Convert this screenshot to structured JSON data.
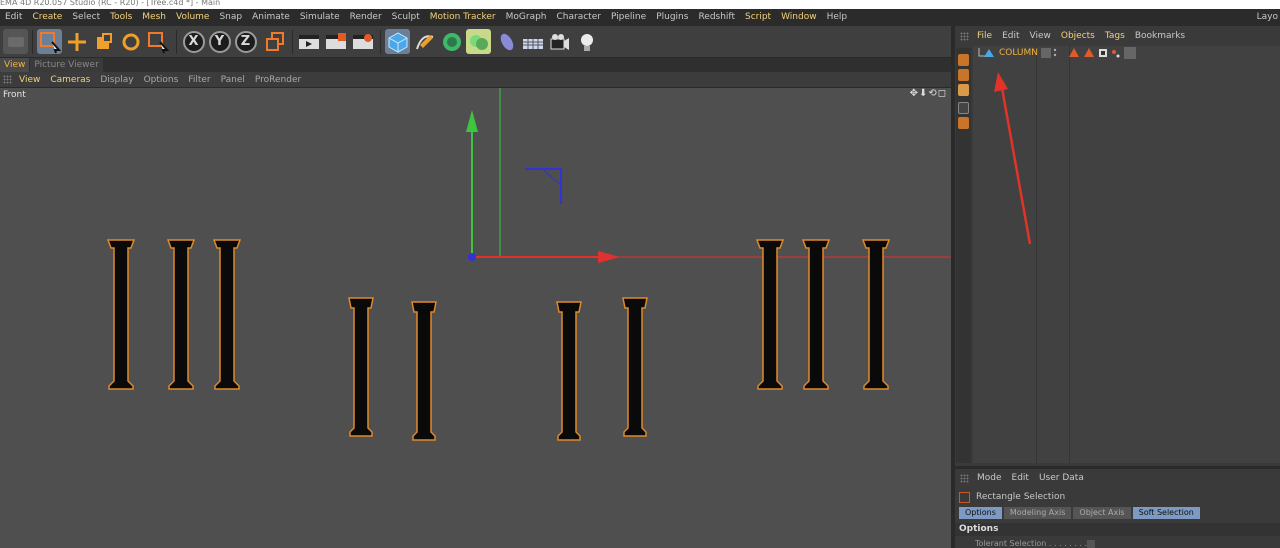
{
  "window": {
    "title": "EMA 4D R20.057 Studio (RC - R20) - [Tree.c4d *] - Main"
  },
  "menubar": {
    "items": [
      {
        "label": "Edit",
        "hl": false
      },
      {
        "label": "Create",
        "hl": true
      },
      {
        "label": "Select",
        "hl": false
      },
      {
        "label": "Tools",
        "hl": true
      },
      {
        "label": "Mesh",
        "hl": true
      },
      {
        "label": "Volume",
        "hl": true
      },
      {
        "label": "Snap",
        "hl": false
      },
      {
        "label": "Animate",
        "hl": false
      },
      {
        "label": "Simulate",
        "hl": false
      },
      {
        "label": "Render",
        "hl": false
      },
      {
        "label": "Sculpt",
        "hl": false
      },
      {
        "label": "Motion Tracker",
        "hl": true
      },
      {
        "label": "MoGraph",
        "hl": false
      },
      {
        "label": "Character",
        "hl": false
      },
      {
        "label": "Pipeline",
        "hl": false
      },
      {
        "label": "Plugins",
        "hl": false
      },
      {
        "label": "Redshift",
        "hl": false
      },
      {
        "label": "Script",
        "hl": true
      },
      {
        "label": "Window",
        "hl": true
      },
      {
        "label": "Help",
        "hl": false
      }
    ],
    "right_label": "Layo"
  },
  "toolbar": {
    "axis_x": "X",
    "axis_y": "Y",
    "axis_z": "Z",
    "icons": [
      "undo-icon",
      "live-selection-icon",
      "move-icon",
      "scale-icon",
      "rotate-icon",
      "last-tool-icon",
      "x-axis-icon",
      "y-axis-icon",
      "z-axis-icon",
      "coordinate-system-icon",
      "render-view-icon",
      "render-picture-viewer-icon",
      "render-settings-icon",
      "cube-icon",
      "pen-spline-icon",
      "subdivision-icon",
      "array-icon",
      "deformer-icon",
      "floor-icon",
      "camera-icon",
      "light-icon"
    ]
  },
  "view_tabs": [
    {
      "label": "View",
      "active": true
    },
    {
      "label": "Picture Viewer",
      "active": false
    }
  ],
  "viewport_menu": [
    {
      "label": "View",
      "hl": true
    },
    {
      "label": "Cameras",
      "hl": true
    },
    {
      "label": "Display",
      "hl": false
    },
    {
      "label": "Options",
      "hl": false
    },
    {
      "label": "Filter",
      "hl": false
    },
    {
      "label": "Panel",
      "hl": false
    },
    {
      "label": "ProRender",
      "hl": false
    }
  ],
  "viewport": {
    "label": "Front",
    "nav_icons": "✥⬇⟲◻"
  },
  "object_manager": {
    "menu": [
      {
        "label": "File",
        "hl": true
      },
      {
        "label": "Edit",
        "hl": false
      },
      {
        "label": "View",
        "hl": false
      },
      {
        "label": "Objects",
        "hl": true
      },
      {
        "label": "Tags",
        "hl": true
      },
      {
        "label": "Bookmarks",
        "hl": false
      }
    ],
    "objects": [
      {
        "name": "COLUMN"
      }
    ]
  },
  "attribute_manager": {
    "menu": [
      {
        "label": "Mode"
      },
      {
        "label": "Edit"
      },
      {
        "label": "User Data"
      }
    ],
    "tool_name": "Rectangle Selection",
    "tabs": [
      {
        "label": "Options",
        "active": true
      },
      {
        "label": "Modeling Axis",
        "active": false
      },
      {
        "label": "Object Axis",
        "active": false
      },
      {
        "label": "Soft Selection",
        "active": true
      }
    ],
    "section_header": "Options",
    "rows": [
      {
        "label": "Tolerant Selection . . . . . . . ."
      }
    ]
  },
  "colors": {
    "accent": "#f2b23d",
    "highlight_text": "#f2d17a",
    "annotation_arrow": "#e0342a",
    "x_axis": "#e03030",
    "y_axis": "#3ec43e",
    "z_axis": "#3232d8"
  }
}
